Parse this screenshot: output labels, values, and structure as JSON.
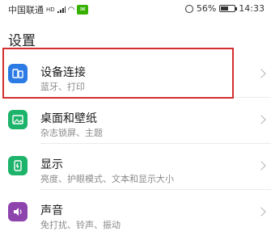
{
  "status_bar": {
    "carrier": "中国联通",
    "hd_label": "HD",
    "battery_percent": "56%",
    "battery_level": 0.56,
    "time": "14:33"
  },
  "page": {
    "title": "设置"
  },
  "items": [
    {
      "title": "设备连接",
      "subtitle": "蓝牙、打印",
      "icon": "device-connection-icon",
      "color": "#2c7be5"
    },
    {
      "title": "桌面和壁纸",
      "subtitle": "杂志锁屏、主题",
      "icon": "wallpaper-icon",
      "color": "#1db36b"
    },
    {
      "title": "显示",
      "subtitle": "亮度、护眼模式、文本和显示大小",
      "icon": "display-icon",
      "color": "#1db36b"
    },
    {
      "title": "声音",
      "subtitle": "免打扰、铃声、振动",
      "icon": "sound-icon",
      "color": "#8e44ad"
    }
  ],
  "annotation": {
    "highlight_color": "#d32f2f"
  }
}
